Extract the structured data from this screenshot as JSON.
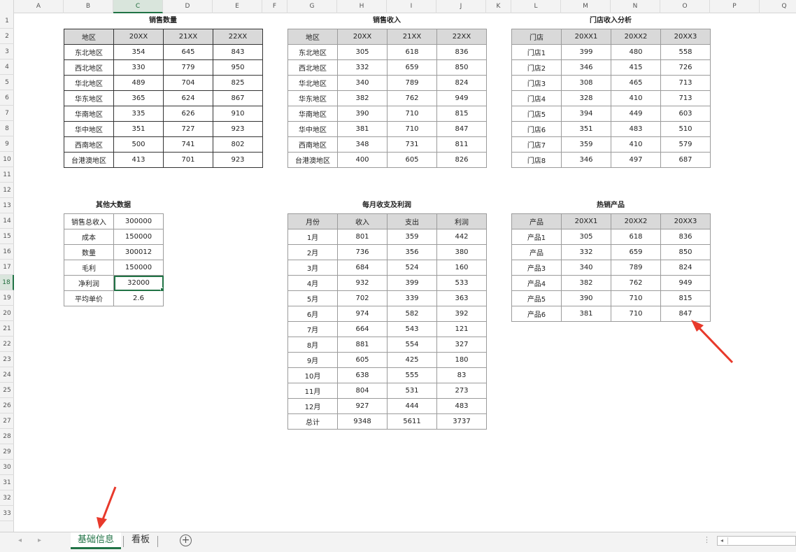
{
  "columns": [
    "A",
    "B",
    "C",
    "D",
    "E",
    "F",
    "G",
    "H",
    "I",
    "J",
    "K",
    "L",
    "M",
    "N",
    "O",
    "P",
    "Q"
  ],
  "active_column": "C",
  "rows": [
    "1",
    "2",
    "3",
    "4",
    "5",
    "6",
    "7",
    "8",
    "9",
    "10",
    "11",
    "12",
    "13",
    "14",
    "15",
    "16",
    "17",
    "18",
    "19",
    "20",
    "21",
    "22",
    "23",
    "24",
    "25",
    "26",
    "27",
    "28",
    "29",
    "30",
    "31",
    "32",
    "33"
  ],
  "active_row": "18",
  "tables": {
    "sales_qty": {
      "title": "销售数量",
      "headers": [
        "地区",
        "20XX",
        "21XX",
        "22XX"
      ],
      "rows": [
        [
          "东北地区",
          "354",
          "645",
          "843"
        ],
        [
          "西北地区",
          "330",
          "779",
          "950"
        ],
        [
          "华北地区",
          "489",
          "704",
          "825"
        ],
        [
          "华东地区",
          "365",
          "624",
          "867"
        ],
        [
          "华南地区",
          "335",
          "626",
          "910"
        ],
        [
          "华中地区",
          "351",
          "727",
          "923"
        ],
        [
          "西南地区",
          "500",
          "741",
          "802"
        ],
        [
          "台港澳地区",
          "413",
          "701",
          "923"
        ]
      ]
    },
    "sales_revenue": {
      "title": "销售收入",
      "headers": [
        "地区",
        "20XX",
        "21XX",
        "22XX"
      ],
      "rows": [
        [
          "东北地区",
          "305",
          "618",
          "836"
        ],
        [
          "西北地区",
          "332",
          "659",
          "850"
        ],
        [
          "华北地区",
          "340",
          "789",
          "824"
        ],
        [
          "华东地区",
          "382",
          "762",
          "949"
        ],
        [
          "华南地区",
          "390",
          "710",
          "815"
        ],
        [
          "华中地区",
          "381",
          "710",
          "847"
        ],
        [
          "西南地区",
          "348",
          "731",
          "811"
        ],
        [
          "台港澳地区",
          "400",
          "605",
          "826"
        ]
      ]
    },
    "store_revenue": {
      "title": "门店收入分析",
      "headers": [
        "门店",
        "20XX1",
        "20XX2",
        "20XX3"
      ],
      "rows": [
        [
          "门店1",
          "399",
          "480",
          "558"
        ],
        [
          "门店2",
          "346",
          "415",
          "726"
        ],
        [
          "门店3",
          "308",
          "465",
          "713"
        ],
        [
          "门店4",
          "328",
          "410",
          "713"
        ],
        [
          "门店5",
          "394",
          "449",
          "603"
        ],
        [
          "门店6",
          "351",
          "483",
          "510"
        ],
        [
          "门店7",
          "359",
          "410",
          "579"
        ],
        [
          "门店8",
          "346",
          "497",
          "687"
        ]
      ]
    },
    "other_data": {
      "title": "其他大数据",
      "rows": [
        [
          "销售总收入",
          "300000"
        ],
        [
          "成本",
          "150000"
        ],
        [
          "数量",
          "300012"
        ],
        [
          "毛利",
          "150000"
        ],
        [
          "净利润",
          "32000"
        ],
        [
          "平均单价",
          "2.6"
        ]
      ]
    },
    "monthly": {
      "title": "每月收支及利润",
      "headers": [
        "月份",
        "收入",
        "支出",
        "利润"
      ],
      "rows": [
        [
          "1月",
          "801",
          "359",
          "442"
        ],
        [
          "2月",
          "736",
          "356",
          "380"
        ],
        [
          "3月",
          "684",
          "524",
          "160"
        ],
        [
          "4月",
          "932",
          "399",
          "533"
        ],
        [
          "5月",
          "702",
          "339",
          "363"
        ],
        [
          "6月",
          "974",
          "582",
          "392"
        ],
        [
          "7月",
          "664",
          "543",
          "121"
        ],
        [
          "8月",
          "881",
          "554",
          "327"
        ],
        [
          "9月",
          "605",
          "425",
          "180"
        ],
        [
          "10月",
          "638",
          "555",
          "83"
        ],
        [
          "11月",
          "804",
          "531",
          "273"
        ],
        [
          "12月",
          "927",
          "444",
          "483"
        ],
        [
          "总计",
          "9348",
          "5611",
          "3737"
        ]
      ]
    },
    "hot_products": {
      "title": "热销产品",
      "headers": [
        "产品",
        "20XX1",
        "20XX2",
        "20XX3"
      ],
      "rows": [
        [
          "产品1",
          "305",
          "618",
          "836"
        ],
        [
          "产品",
          "332",
          "659",
          "850"
        ],
        [
          "产品3",
          "340",
          "789",
          "824"
        ],
        [
          "产品4",
          "382",
          "762",
          "949"
        ],
        [
          "产品5",
          "390",
          "710",
          "815"
        ],
        [
          "产品6",
          "381",
          "710",
          "847"
        ]
      ]
    }
  },
  "sheet_tabs": [
    {
      "label": "基础信息",
      "active": true
    },
    {
      "label": "看板",
      "active": false
    }
  ],
  "add_sheet_label": "+",
  "nav_prev": "◂",
  "nav_next": "▸",
  "scroll_left": "◂",
  "more_dots": "⋮",
  "colors": {
    "accent": "#217346",
    "header_fill": "#d9d9d9",
    "arrow": "#e8392b"
  }
}
